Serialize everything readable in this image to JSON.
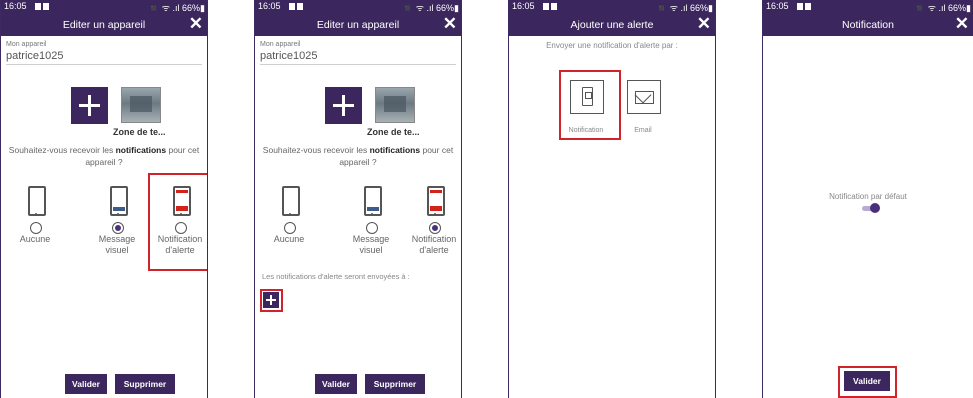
{
  "status": {
    "time": "16:05",
    "right": "◾ ᯤ .ıl 66%▮"
  },
  "screens": [
    {
      "title": "Editer un appareil",
      "close": "✕",
      "device_label": "Mon appareil",
      "device_name": "patrice1025",
      "zone": "Zone de te...",
      "question_pre": "Souhaitez-vous recevoir les ",
      "question_bold": "notifications",
      "question_post": " pour cet appareil ?",
      "options": [
        {
          "label1": "Aucune",
          "label2": ""
        },
        {
          "label1": "Message",
          "label2": "visuel"
        },
        {
          "label1": "Notification",
          "label2": "d'alerte"
        }
      ],
      "selected": 1,
      "validate": "Valider",
      "delete": "Supprimer"
    },
    {
      "title": "Editer un appareil",
      "close": "✕",
      "device_label": "Mon appareil",
      "device_name": "patrice1025",
      "zone": "Zone de te...",
      "question_pre": "Souhaitez-vous recevoir les ",
      "question_bold": "notifications",
      "question_post": " pour cet appareil ?",
      "options": [
        {
          "label1": "Aucune",
          "label2": ""
        },
        {
          "label1": "Message",
          "label2": "visuel"
        },
        {
          "label1": "Notification",
          "label2": "d'alerte"
        }
      ],
      "selected": 2,
      "hint": "Les notifications d'alerte seront envoyées à :",
      "validate": "Valider",
      "delete": "Supprimer"
    },
    {
      "title": "Ajouter une alerte",
      "close": "✕",
      "send_by": "Envoyer une notification d'alerte par :",
      "notification": "Notification",
      "email": "Email"
    },
    {
      "title": "Notification",
      "close": "✕",
      "default_notification": "Notification par défaut",
      "validate": "Valider"
    }
  ],
  "colors": {
    "brand": "#3b275e",
    "highlight": "#d0232b"
  }
}
